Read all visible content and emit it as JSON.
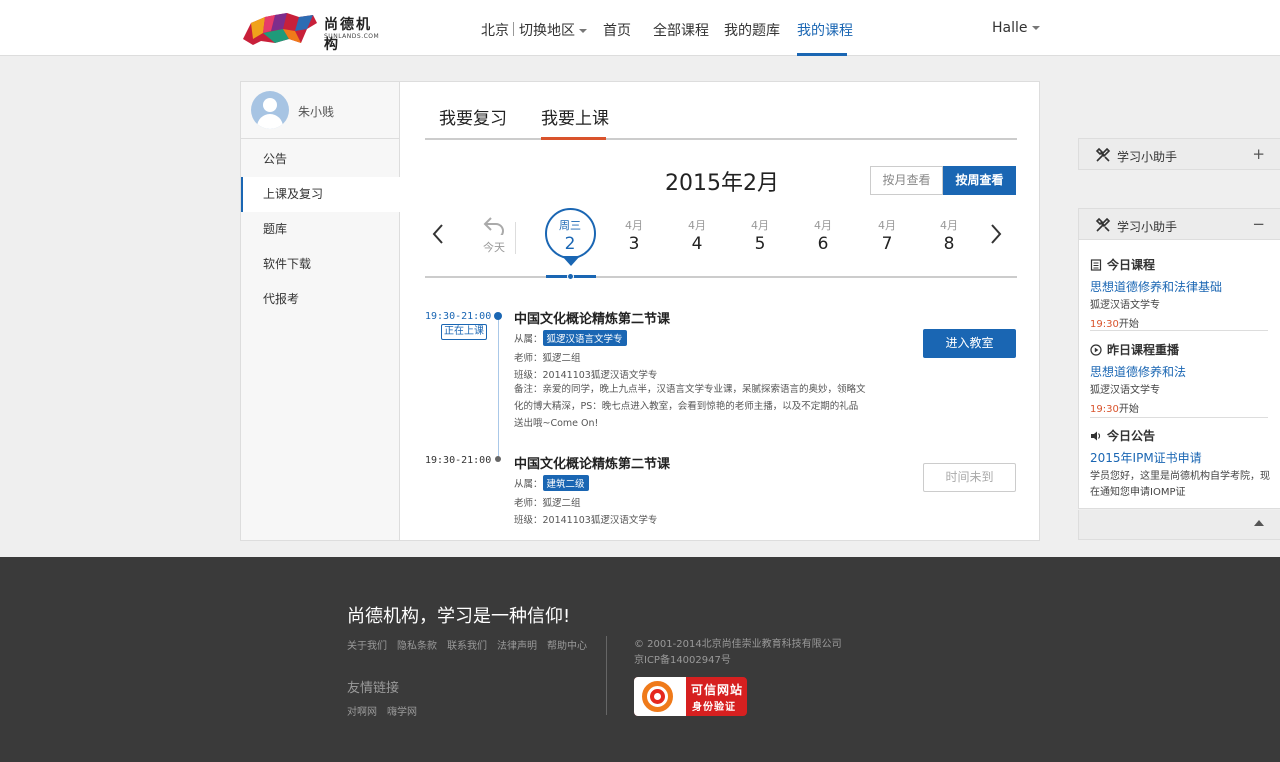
{
  "header": {
    "logo_name": "尚德机构",
    "logo_sub": "SUNLANDS.COM",
    "city": "北京",
    "switch_region": "切换地区",
    "nav": [
      "首页",
      "全部课程",
      "我的题库",
      "我的课程"
    ],
    "user": "Halle"
  },
  "sidebar": {
    "username": "朱小贱",
    "items": [
      "公告",
      "上课及复习",
      "题库",
      "软件下载",
      "代报考"
    ]
  },
  "tabs": [
    "我要复习",
    "我要上课"
  ],
  "calendar": {
    "month": "2015年2月",
    "view_month": "按月查看",
    "view_week": "按周查看",
    "today": "今天",
    "days": [
      {
        "wd": "周三",
        "num": "2"
      },
      {
        "wd": "4月",
        "num": "3"
      },
      {
        "wd": "4月",
        "num": "4"
      },
      {
        "wd": "4月",
        "num": "5"
      },
      {
        "wd": "4月",
        "num": "6"
      },
      {
        "wd": "4月",
        "num": "7"
      },
      {
        "wd": "4月",
        "num": "8"
      }
    ]
  },
  "courses": [
    {
      "time": "19:30-21:00",
      "status": "正在上课",
      "title": "中国文化概论精炼第二节课",
      "from_label": "从属：",
      "tag": "狐逻汉语言文学专",
      "teacher": "老师：狐逻二组",
      "class": "班级：20141103狐逻汉语文学专",
      "note": "备注：亲爱的同学，晚上九点半，汉语言文学专业课，呆腻探索语言的奥妙，领略文化的博大精深，PS：晚七点进入教室，会看到惊艳的老师主播，以及不定期的礼品送出哦~Come On!",
      "button": "进入教室"
    },
    {
      "time": "19:30-21:00",
      "title": "中国文化概论精炼第二节课",
      "from_label": "从属：",
      "tag": "建筑二级",
      "teacher": "老师：狐逻二组",
      "class": "班级：20141103狐逻汉语文学专",
      "button": "时间未到"
    }
  ],
  "assistant": {
    "title": "学习小助手",
    "expand": "+",
    "collapse": "−",
    "today_course": {
      "head": "今日课程",
      "link": "思想道德修养和法律基础",
      "text": "狐逻汉语文学专",
      "time": "19:30",
      "suffix": "开始"
    },
    "replay": {
      "head": "昨日课程重播",
      "link": "思想道德修养和法",
      "text": "狐逻汉语文学专",
      "time": "19:30",
      "suffix": "开始"
    },
    "notice": {
      "head": "今日公告",
      "link": "2015年IPM证书申请",
      "text": "学员您好，这里是尚德机构自学考院，现在通知您申请IOMP证"
    }
  },
  "footer": {
    "slogan": "尚德机构，学习是一种信仰!",
    "links": [
      "关于我们",
      "隐私条款",
      "联系我们",
      "法律声明",
      "帮助中心"
    ],
    "friend_title": "友情链接",
    "friend_links": [
      "对啊网",
      "嗨学网"
    ],
    "copyright": "© 2001-2014北京尚佳崇业教育科技有限公司",
    "icp": "京ICP备14002947号",
    "badge_title": "可信网站",
    "badge_sub": "身份验证"
  },
  "colors": {
    "accent": "#1a66b3",
    "highlight": "#d9532c",
    "footer_bg": "#3a3a3a"
  }
}
